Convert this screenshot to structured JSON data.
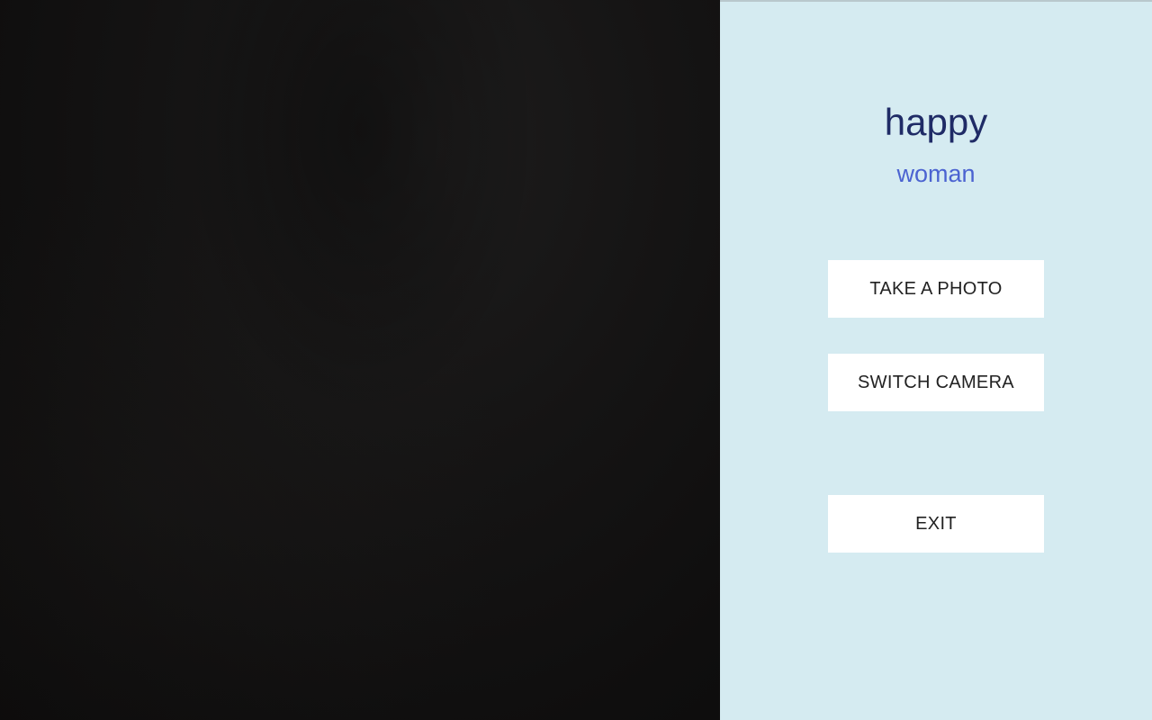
{
  "camera": {
    "preview_label": "camera-preview"
  },
  "panel": {
    "emotion": "happy",
    "gender": "woman",
    "buttons": {
      "take_photo": "TAKE A PHOTO",
      "switch_camera": "SWITCH CAMERA",
      "exit": "EXIT"
    }
  },
  "colors": {
    "panel_background": "#d5ebf1",
    "emotion_text": "#1f2b66",
    "gender_text": "#4b63d1",
    "button_background": "#ffffff"
  }
}
